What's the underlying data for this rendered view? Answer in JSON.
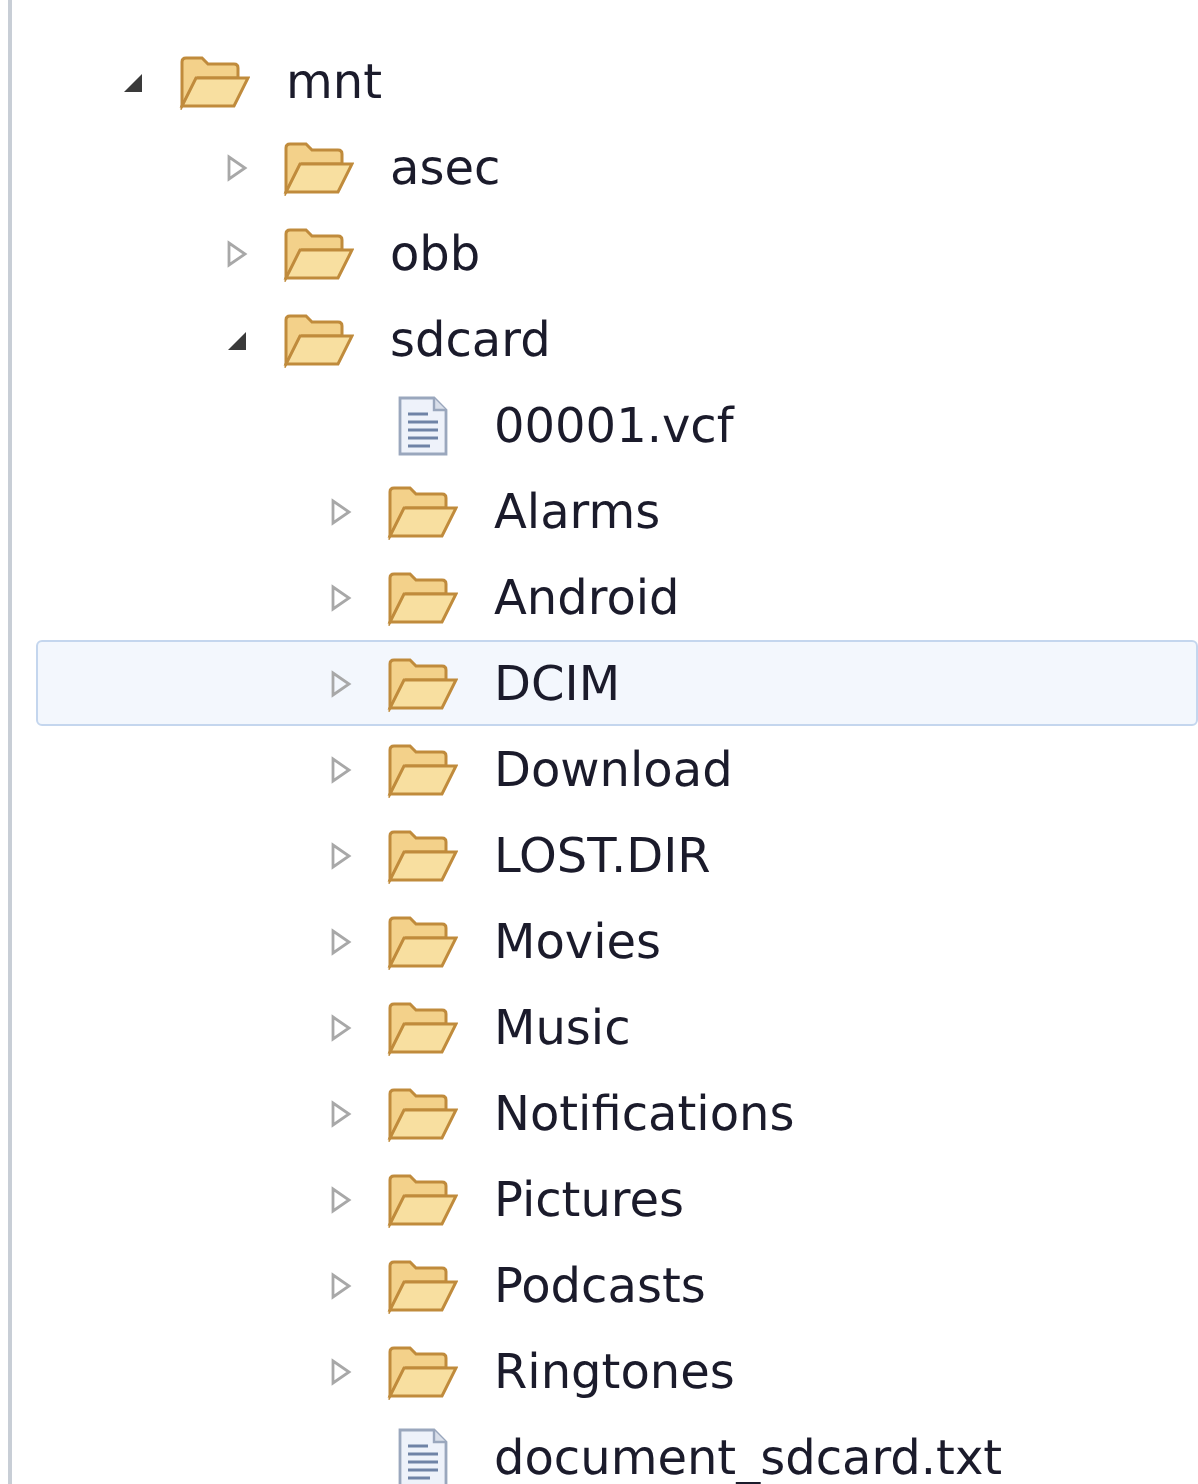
{
  "tree": [
    {
      "kind": "folder",
      "label": "mnt",
      "expanded": true,
      "selected": false,
      "children": [
        {
          "kind": "folder",
          "label": "asec",
          "expanded": false,
          "selected": false
        },
        {
          "kind": "folder",
          "label": "obb",
          "expanded": false,
          "selected": false
        },
        {
          "kind": "folder",
          "label": "sdcard",
          "expanded": true,
          "selected": false,
          "children": [
            {
              "kind": "file",
              "label": "00001.vcf",
              "selected": false
            },
            {
              "kind": "folder",
              "label": "Alarms",
              "expanded": false,
              "selected": false
            },
            {
              "kind": "folder",
              "label": "Android",
              "expanded": false,
              "selected": false
            },
            {
              "kind": "folder",
              "label": "DCIM",
              "expanded": false,
              "selected": true
            },
            {
              "kind": "folder",
              "label": "Download",
              "expanded": false,
              "selected": false
            },
            {
              "kind": "folder",
              "label": "LOST.DIR",
              "expanded": false,
              "selected": false
            },
            {
              "kind": "folder",
              "label": "Movies",
              "expanded": false,
              "selected": false
            },
            {
              "kind": "folder",
              "label": "Music",
              "expanded": false,
              "selected": false
            },
            {
              "kind": "folder",
              "label": "Notifications",
              "expanded": false,
              "selected": false
            },
            {
              "kind": "folder",
              "label": "Pictures",
              "expanded": false,
              "selected": false
            },
            {
              "kind": "folder",
              "label": "Podcasts",
              "expanded": false,
              "selected": false
            },
            {
              "kind": "folder",
              "label": "Ringtones",
              "expanded": false,
              "selected": false
            },
            {
              "kind": "file",
              "label": "document_sdcard.txt",
              "selected": false
            }
          ]
        }
      ]
    }
  ]
}
